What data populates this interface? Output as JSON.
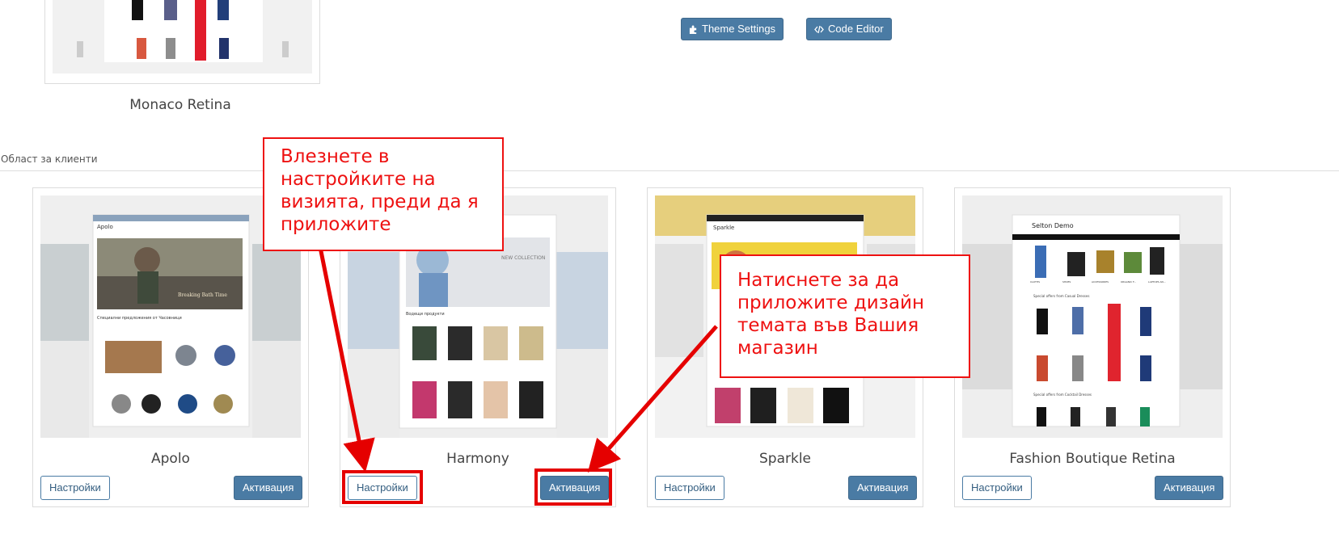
{
  "top_theme": {
    "name": "Monaco Retina",
    "buttons": {
      "theme_settings": "Theme Settings",
      "code_editor": "Code Editor"
    }
  },
  "section": {
    "label": "Област за клиенти"
  },
  "themes": [
    {
      "name": "Apolo",
      "settings": "Настройки",
      "activate": "Активация",
      "preview": {
        "logo": "Apolo",
        "banner": "Breaking Bath Time",
        "subtitle": "Специални предложения от Часовници"
      }
    },
    {
      "name": "Harmony",
      "settings": "Настройки",
      "activate": "Активация",
      "preview": {
        "banner": "NEW COLLECTION",
        "subtitle": "Водещи продукти"
      }
    },
    {
      "name": "Sparkle",
      "settings": "Настройки",
      "activate": "Активация",
      "preview": {
        "logo": "Sparkle"
      }
    },
    {
      "name": "Fashion Boutique Retina",
      "settings": "Настройки",
      "activate": "Активация",
      "preview": {
        "logo": "Selton Demo",
        "cats": [
          "CLOTHS",
          "SHOES",
          "ACCESSORIES",
          "ORGANIC F...",
          "LAPTOPS AN..."
        ],
        "sub1": "Special offers from Casual Dresses",
        "sub2": "Special offers from Cocktail Dresses"
      }
    }
  ],
  "annotations": {
    "settings_hint": "Влезнете в настройките на визията, преди да я приложите",
    "activate_hint": "Натиснете за да приложите дизайн темата във Вашия магазин"
  },
  "colors": {
    "accent": "#4a7ba4",
    "annotation_red": "#e50000"
  }
}
